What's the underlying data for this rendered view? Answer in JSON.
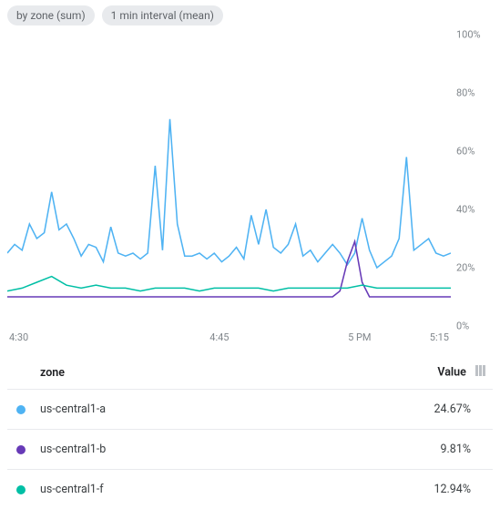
{
  "pills": {
    "group": "by zone (sum)",
    "interval": "1 min interval (mean)"
  },
  "chart_data": {
    "type": "line",
    "ylabel": "",
    "xlabel": "",
    "ylim": [
      0,
      100
    ],
    "y_unit": "%",
    "y_ticks": [
      0,
      20,
      40,
      60,
      80,
      100
    ],
    "x_ticks": [
      "4:30",
      "4:45",
      "5 PM",
      "5:15"
    ],
    "x_range_minutes": [
      15,
      75
    ],
    "series": [
      {
        "name": "us-central1-a",
        "color": "#4fb3f3",
        "values": [
          [
            15,
            25
          ],
          [
            16,
            28
          ],
          [
            17,
            26
          ],
          [
            18,
            35
          ],
          [
            19,
            30
          ],
          [
            20,
            32
          ],
          [
            21,
            46
          ],
          [
            22,
            33
          ],
          [
            23,
            35
          ],
          [
            24,
            30
          ],
          [
            25,
            24
          ],
          [
            26,
            28
          ],
          [
            27,
            27
          ],
          [
            28,
            22
          ],
          [
            29,
            34
          ],
          [
            30,
            25
          ],
          [
            31,
            24
          ],
          [
            32,
            25
          ],
          [
            33,
            23
          ],
          [
            34,
            25
          ],
          [
            35,
            55
          ],
          [
            36,
            26
          ],
          [
            37,
            71
          ],
          [
            38,
            35
          ],
          [
            39,
            24
          ],
          [
            40,
            24
          ],
          [
            41,
            25
          ],
          [
            42,
            23
          ],
          [
            43,
            25
          ],
          [
            44,
            22
          ],
          [
            45,
            24
          ],
          [
            46,
            27
          ],
          [
            47,
            23
          ],
          [
            48,
            38
          ],
          [
            49,
            28
          ],
          [
            50,
            40
          ],
          [
            51,
            27
          ],
          [
            52,
            25
          ],
          [
            53,
            28
          ],
          [
            54,
            35
          ],
          [
            55,
            24
          ],
          [
            56,
            26
          ],
          [
            57,
            22
          ],
          [
            58,
            25
          ],
          [
            59,
            28
          ],
          [
            60,
            25
          ],
          [
            61,
            21
          ],
          [
            62,
            25
          ],
          [
            63,
            37
          ],
          [
            64,
            26
          ],
          [
            65,
            20
          ],
          [
            66,
            22
          ],
          [
            67,
            24
          ],
          [
            68,
            30
          ],
          [
            69,
            58
          ],
          [
            70,
            26
          ],
          [
            71,
            28
          ],
          [
            72,
            30
          ],
          [
            73,
            25
          ],
          [
            74,
            24
          ],
          [
            75,
            25
          ]
        ]
      },
      {
        "name": "us-central1-b",
        "color": "#673ab7",
        "values": [
          [
            15,
            10
          ],
          [
            18,
            10
          ],
          [
            21,
            10
          ],
          [
            24,
            10
          ],
          [
            27,
            10
          ],
          [
            30,
            10
          ],
          [
            33,
            10
          ],
          [
            36,
            10
          ],
          [
            39,
            10
          ],
          [
            42,
            10
          ],
          [
            45,
            10
          ],
          [
            48,
            10
          ],
          [
            51,
            10
          ],
          [
            54,
            10
          ],
          [
            57,
            10
          ],
          [
            59,
            10
          ],
          [
            60,
            12
          ],
          [
            61,
            22
          ],
          [
            62,
            29
          ],
          [
            63,
            15
          ],
          [
            64,
            10
          ],
          [
            66,
            10
          ],
          [
            69,
            10
          ],
          [
            72,
            10
          ],
          [
            75,
            10
          ]
        ]
      },
      {
        "name": "us-central1-f",
        "color": "#00bfa5",
        "values": [
          [
            15,
            12
          ],
          [
            17,
            13
          ],
          [
            19,
            15
          ],
          [
            21,
            17
          ],
          [
            23,
            14
          ],
          [
            25,
            13
          ],
          [
            27,
            14
          ],
          [
            29,
            13
          ],
          [
            31,
            13
          ],
          [
            33,
            12
          ],
          [
            35,
            13
          ],
          [
            37,
            13
          ],
          [
            39,
            13
          ],
          [
            41,
            12
          ],
          [
            43,
            13
          ],
          [
            45,
            13
          ],
          [
            47,
            13
          ],
          [
            49,
            13
          ],
          [
            51,
            12
          ],
          [
            53,
            13
          ],
          [
            55,
            13
          ],
          [
            57,
            13
          ],
          [
            59,
            13
          ],
          [
            61,
            13
          ],
          [
            63,
            14
          ],
          [
            65,
            13
          ],
          [
            67,
            13
          ],
          [
            69,
            13
          ],
          [
            71,
            13
          ],
          [
            73,
            13
          ],
          [
            75,
            13
          ]
        ]
      }
    ]
  },
  "legend": {
    "header_zone": "zone",
    "header_value": "Value",
    "rows": [
      {
        "name": "us-central1-a",
        "value": "24.67%",
        "color": "#4fb3f3"
      },
      {
        "name": "us-central1-b",
        "value": "9.81%",
        "color": "#673ab7"
      },
      {
        "name": "us-central1-f",
        "value": "12.94%",
        "color": "#00bfa5"
      }
    ]
  }
}
